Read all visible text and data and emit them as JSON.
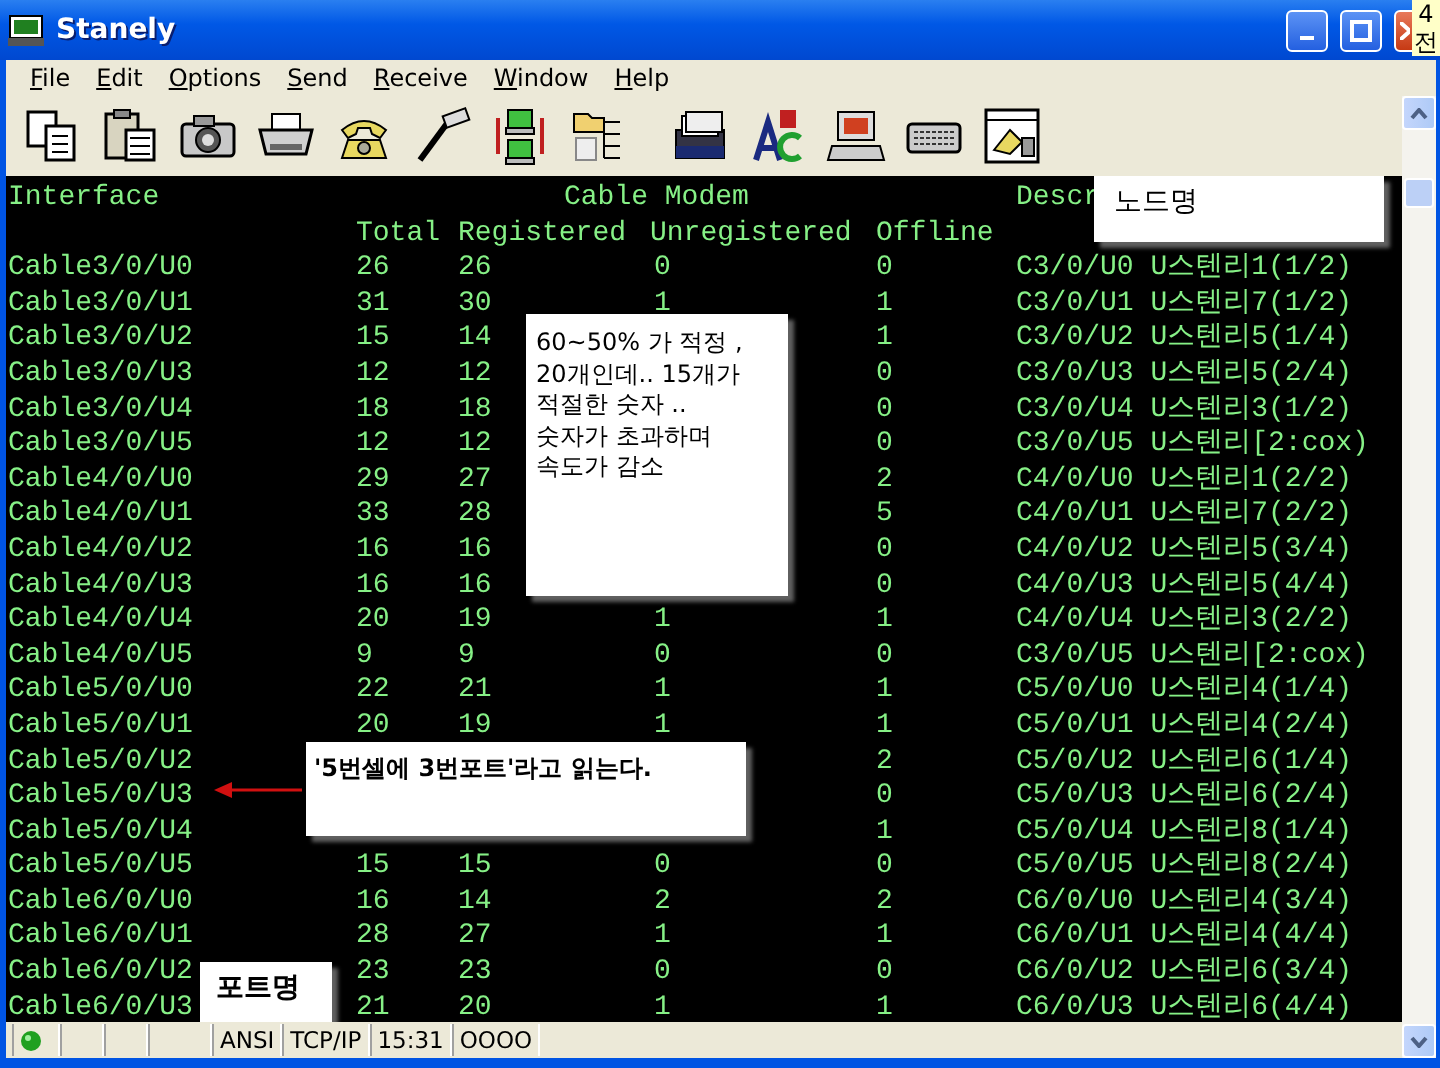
{
  "window": {
    "title": "Stanely"
  },
  "corner_note": {
    "lines": [
      "4",
      "전"
    ]
  },
  "menu": [
    {
      "label": "File"
    },
    {
      "label": "Edit"
    },
    {
      "label": "Options"
    },
    {
      "label": "Send"
    },
    {
      "label": "Receive"
    },
    {
      "label": "Window"
    },
    {
      "label": "Help"
    }
  ],
  "terminal": {
    "header": {
      "interface": "Interface",
      "group": "Cable Modem",
      "description": "Descr",
      "total": "Total",
      "registered": "Registered",
      "unregistered": "Unregistered",
      "offline": "Offline"
    },
    "rows": [
      {
        "interface": "Cable3/0/U0",
        "total": "26",
        "registered": "26",
        "unregistered": "0",
        "offline": "0",
        "description": "C3/0/U0 U스텐리1(1/2)"
      },
      {
        "interface": "Cable3/0/U1",
        "total": "31",
        "registered": "30",
        "unregistered": "1",
        "offline": "1",
        "description": "C3/0/U1 U스텐리7(1/2)"
      },
      {
        "interface": "Cable3/0/U2",
        "total": "15",
        "registered": "14",
        "offline": "1",
        "description": "C3/0/U2 U스텐리5(1/4)"
      },
      {
        "interface": "Cable3/0/U3",
        "total": "12",
        "registered": "12",
        "offline": "0",
        "description": "C3/0/U3 U스텐리5(2/4)"
      },
      {
        "interface": "Cable3/0/U4",
        "total": "18",
        "registered": "18",
        "offline": "0",
        "description": "C3/0/U4 U스텐리3(1/2)"
      },
      {
        "interface": "Cable3/0/U5",
        "total": "12",
        "registered": "12",
        "offline": "0",
        "description": "C3/0/U5 U스텐리[2:cox)"
      },
      {
        "interface": "Cable4/0/U0",
        "total": "29",
        "registered": "27",
        "offline": "2",
        "description": "C4/0/U0 U스텐리1(2/2)"
      },
      {
        "interface": "Cable4/0/U1",
        "total": "33",
        "registered": "28",
        "offline": "5",
        "description": "C4/0/U1 U스텐리7(2/2)"
      },
      {
        "interface": "Cable4/0/U2",
        "total": "16",
        "registered": "16",
        "offline": "0",
        "description": "C4/0/U2 U스텐리5(3/4)"
      },
      {
        "interface": "Cable4/0/U3",
        "total": "16",
        "registered": "16",
        "offline": "0",
        "description": "C4/0/U3 U스텐리5(4/4)"
      },
      {
        "interface": "Cable4/0/U4",
        "total": "20",
        "registered": "19",
        "unregistered": "1",
        "offline": "1",
        "description": "C4/0/U4 U스텐리3(2/2)"
      },
      {
        "interface": "Cable4/0/U5",
        "total": "9",
        "registered": "9",
        "unregistered": "0",
        "offline": "0",
        "description": "C3/0/U5 U스텐리[2:cox)"
      },
      {
        "interface": "Cable5/0/U0",
        "total": "22",
        "registered": "21",
        "unregistered": "1",
        "offline": "1",
        "description": "C5/0/U0 U스텐리4(1/4)"
      },
      {
        "interface": "Cable5/0/U1",
        "total": "20",
        "registered": "19",
        "unregistered": "1",
        "offline": "1",
        "description": "C5/0/U1 U스텐리4(2/4)"
      },
      {
        "interface": "Cable5/0/U2",
        "offline": "2",
        "description": "C5/0/U2 U스텐리6(1/4)"
      },
      {
        "interface": "Cable5/0/U3",
        "offline": "0",
        "description": "C5/0/U3 U스텐리6(2/4)"
      },
      {
        "interface": "Cable5/0/U4",
        "offline": "1",
        "description": "C5/0/U4 U스텐리8(1/4)"
      },
      {
        "interface": "Cable5/0/U5",
        "total": "15",
        "registered": "15",
        "unregistered": "0",
        "offline": "0",
        "description": "C5/0/U5 U스텐리8(2/4)"
      },
      {
        "interface": "Cable6/0/U0",
        "total": "16",
        "registered": "14",
        "unregistered": "2",
        "offline": "2",
        "description": "C6/0/U0 U스텐리4(3/4)"
      },
      {
        "interface": "Cable6/0/U1",
        "total": "28",
        "registered": "27",
        "unregistered": "1",
        "offline": "1",
        "description": "C6/0/U1 U스텐리4(4/4)"
      },
      {
        "interface": "Cable6/0/U2",
        "total": "23",
        "registered": "23",
        "unregistered": "0",
        "offline": "0",
        "description": "C6/0/U2 U스텐리6(3/4)"
      },
      {
        "interface": "Cable6/0/U3",
        "total": "21",
        "registered": "20",
        "unregistered": "1",
        "offline": "1",
        "description": "C6/0/U3 U스텐리6(4/4)"
      }
    ]
  },
  "annotations": {
    "capacity_note": {
      "lines": [
        "60~50% 가 적정 ,",
        "20개인데.. 15개가",
        "적절한 숫자 ..",
        "숫자가 초과하며",
        "속도가 감소"
      ]
    },
    "port_reading_note": {
      "text": "'5번셀에 3번포트'라고 읽는다."
    },
    "node_name_label": {
      "text": "노드명"
    },
    "port_name_label": {
      "text": "포트명"
    }
  },
  "status_bar": {
    "panes": [
      "ANSI",
      "TCP/IP",
      "15:31",
      "OOOO"
    ]
  }
}
